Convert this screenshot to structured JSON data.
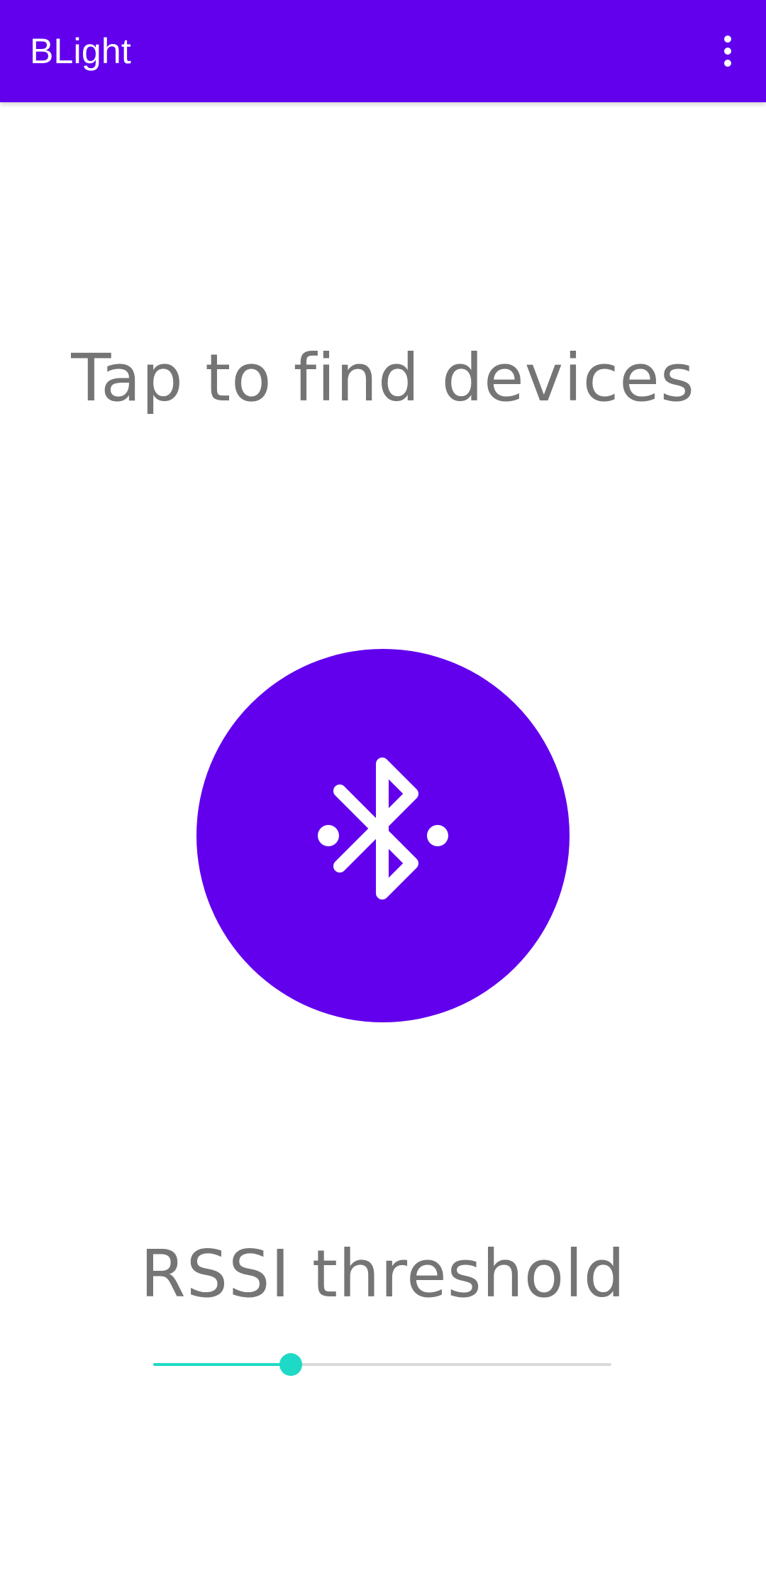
{
  "app_bar": {
    "title": "BLight",
    "overflow_icon": "more-vert-icon",
    "background_color": "#6200EE",
    "text_color": "#FFFFFF"
  },
  "main": {
    "prompt": "Tap to find devices",
    "scan_button": {
      "icon": "bluetooth-searching-icon",
      "color": "#6200EE"
    }
  },
  "rssi": {
    "label": "RSSI threshold",
    "slider": {
      "value_fraction": 0.3,
      "active_color": "#1ED9C6",
      "inactive_color": "#D9D9D9"
    }
  }
}
